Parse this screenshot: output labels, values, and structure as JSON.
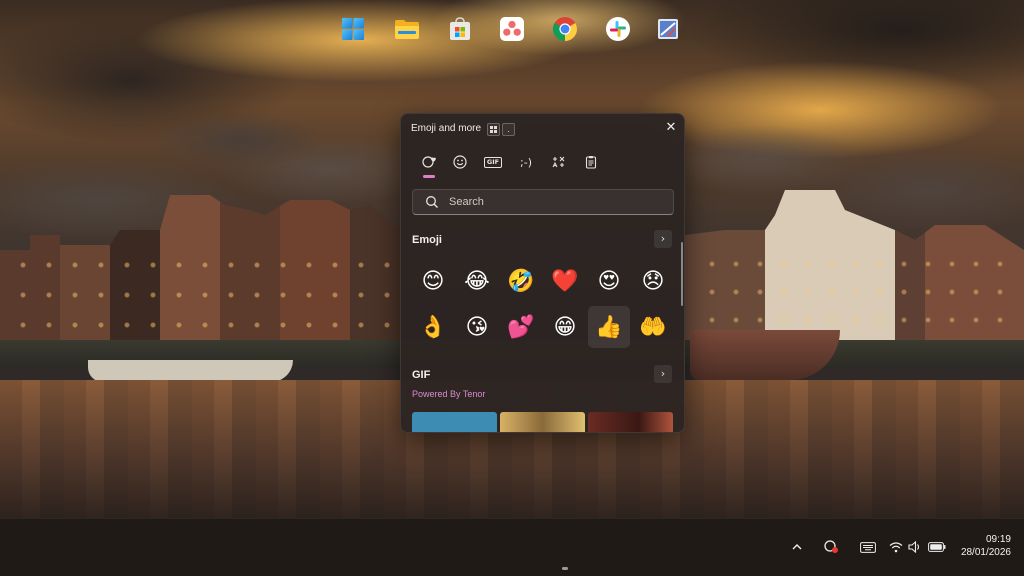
{
  "emoji_panel": {
    "title": "Emoji and more",
    "shortcut_keys": [
      "win-key",
      "period-key"
    ],
    "shortcut_period": ".",
    "close_glyph": "✕",
    "tabs": [
      {
        "id": "recent",
        "icon": "recent-heart-icon",
        "active": true
      },
      {
        "id": "emoji",
        "icon": "smiley-icon",
        "active": false
      },
      {
        "id": "gif",
        "label": "GIF",
        "icon": "gif-icon",
        "active": false
      },
      {
        "id": "kaomoji",
        "label": ";-)",
        "icon": "kaomoji-icon",
        "active": false
      },
      {
        "id": "symbols",
        "icon": "symbols-icon",
        "active": false
      },
      {
        "id": "clipboard",
        "icon": "clipboard-icon",
        "active": false
      }
    ],
    "search": {
      "placeholder": "Search",
      "value": ""
    },
    "emoji_section": {
      "title": "Emoji",
      "arrow": "›",
      "items": [
        {
          "name": "smiling-face",
          "char": "😊"
        },
        {
          "name": "face-with-tears-of-joy",
          "char": "😂"
        },
        {
          "name": "rolling-on-the-floor-laughing",
          "char": "🤣"
        },
        {
          "name": "red-heart",
          "char": "❤️"
        },
        {
          "name": "smiling-face-with-heart-eyes",
          "char": "😍"
        },
        {
          "name": "disappointed-face",
          "char": "😞"
        },
        {
          "name": "ok-hand",
          "char": "👌"
        },
        {
          "name": "face-blowing-a-kiss",
          "char": "😘"
        },
        {
          "name": "two-hearts",
          "char": "💕"
        },
        {
          "name": "beaming-face",
          "char": "😁"
        },
        {
          "name": "thumbs-up",
          "char": "👍",
          "selected": true
        },
        {
          "name": "palms-up-together",
          "char": "🤲"
        }
      ]
    },
    "gif_section": {
      "title": "GIF",
      "subtitle": "Powered By Tenor",
      "arrow": "›"
    }
  },
  "taskbar": {
    "apps": [
      {
        "id": "start",
        "icon": "windows-start-icon"
      },
      {
        "id": "file-explorer",
        "icon": "folder-icon"
      },
      {
        "id": "microsoft-store",
        "icon": "store-icon"
      },
      {
        "id": "asana",
        "icon": "asana-icon"
      },
      {
        "id": "chrome",
        "icon": "chrome-icon",
        "running": true
      },
      {
        "id": "slack",
        "icon": "slack-icon"
      },
      {
        "id": "snipping-tool",
        "icon": "snipping-tool-icon"
      }
    ],
    "tray": [
      "chevron-up-icon",
      "screen-record-icon",
      "keyboard-icon",
      "wifi-icon",
      "volume-icon",
      "battery-icon"
    ],
    "clock": {
      "time": "09:19",
      "date": "28/01/2026"
    }
  },
  "colors": {
    "accent_pink": "#e07fc9",
    "powered_by_text": "#d88cd0",
    "panel_bg": "#2c2422"
  }
}
